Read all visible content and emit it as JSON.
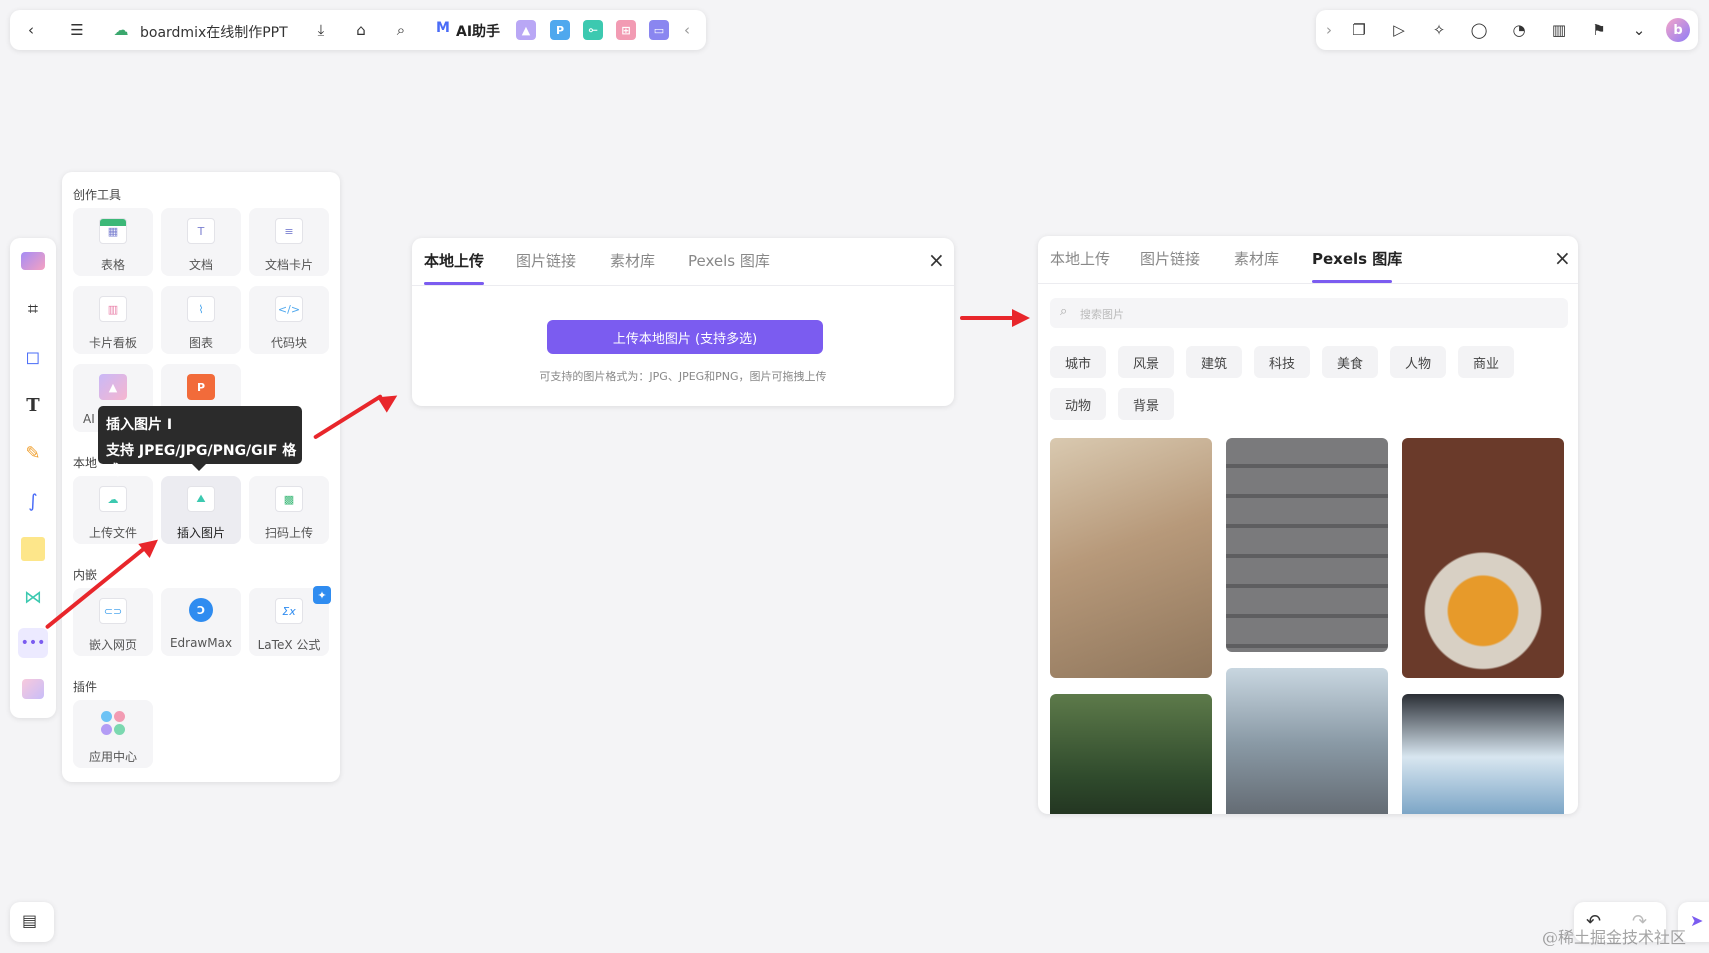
{
  "topbar": {
    "doc_title": "boardmix在线制作PPT",
    "ai_label": "AI助手"
  },
  "tools_panel": {
    "section_create": "创作工具",
    "create_tools": [
      {
        "label": "表格",
        "icon": "table-icon"
      },
      {
        "label": "文档",
        "icon": "doc-icon"
      },
      {
        "label": "文档卡片",
        "icon": "doc-card-icon"
      },
      {
        "label": "卡片看板",
        "icon": "kanban-icon"
      },
      {
        "label": "图表",
        "icon": "chart-icon"
      },
      {
        "label": "代码块",
        "icon": "code-icon"
      },
      {
        "label": "AI",
        "icon": "ai-image-icon"
      },
      {
        "label": "",
        "icon": "ppt-icon"
      }
    ],
    "section_local": "本地",
    "local_tools": [
      {
        "label": "上传文件",
        "icon": "upload-file-icon"
      },
      {
        "label": "插入图片",
        "icon": "insert-image-icon"
      },
      {
        "label": "扫码上传",
        "icon": "qr-upload-icon"
      }
    ],
    "section_embed": "内嵌",
    "embed_tools": [
      {
        "label": "嵌入网页",
        "icon": "embed-web-icon"
      },
      {
        "label": "EdrawMax",
        "icon": "edrawmax-icon"
      },
      {
        "label": "LaTeX 公式",
        "icon": "latex-icon"
      }
    ],
    "section_plugin": "插件",
    "plugin_tools": [
      {
        "label": "应用中心",
        "icon": "app-center-icon"
      }
    ]
  },
  "tooltip": {
    "line1": "插入图片 I",
    "line2": "支持 JPEG/JPG/PNG/GIF 格式"
  },
  "upload_dialog": {
    "tabs": [
      "本地上传",
      "图片链接",
      "素材库",
      "Pexels 图库"
    ],
    "active_tab": 0,
    "upload_button": "上传本地图片 (支持多选)",
    "hint": "可支持的图片格式为：JPG、JPEG和PNG，图片可拖拽上传"
  },
  "pexels_dialog": {
    "tabs": [
      "本地上传",
      "图片链接",
      "素材库",
      "Pexels 图库"
    ],
    "active_tab": 3,
    "search_placeholder": "搜索图片",
    "categories": [
      "城市",
      "风景",
      "建筑",
      "科技",
      "美食",
      "人物",
      "商业",
      "动物",
      "背景"
    ],
    "photos": [
      {
        "subject": "room-with-bookshelves",
        "color": "#b7997a"
      },
      {
        "subject": "stone-wall-children",
        "color": "#6e6e70"
      },
      {
        "subject": "pouring-sauce-food",
        "color": "#6a3a2a"
      },
      {
        "subject": "woman-in-forest",
        "color": "#2f4a2c"
      },
      {
        "subject": "snowy-mountains",
        "color": "#8a9aa6"
      },
      {
        "subject": "glacier-ice",
        "color": "#5c8fb8"
      }
    ]
  },
  "watermark": "@稀土掘金技术社区",
  "colors": {
    "accent": "#7b5cf0",
    "arrow": "#e8262b"
  }
}
